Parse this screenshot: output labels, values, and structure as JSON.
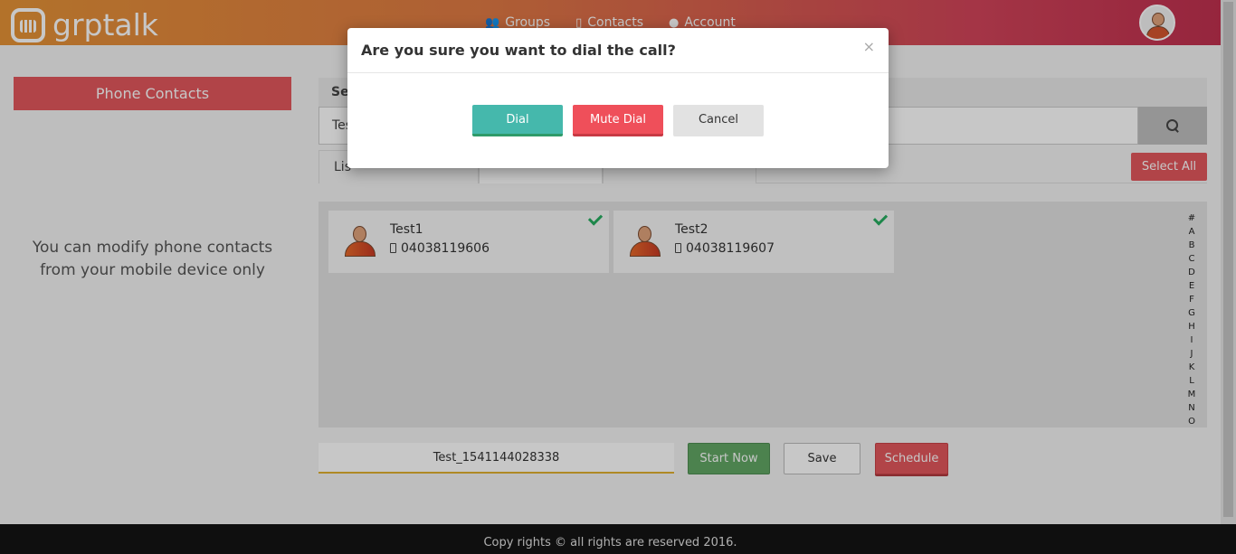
{
  "header": {
    "logo_text": "grptalk",
    "nav": [
      {
        "label": "Groups",
        "icon": "users-icon"
      },
      {
        "label": "Contacts",
        "icon": "mobile-icon"
      },
      {
        "label": "Account",
        "icon": "user-icon"
      }
    ]
  },
  "sidebar": {
    "button_label": "Phone Contacts",
    "note": "You can modify phone contacts from your mobile device only"
  },
  "search": {
    "label": "Se",
    "value": "Tes"
  },
  "tabs": [
    {
      "label": "Lis"
    },
    {
      "label": ""
    },
    {
      "label": ""
    }
  ],
  "select_all_label": "Select All",
  "contacts": [
    {
      "name": "Test1",
      "phone": "04038119606",
      "selected": true
    },
    {
      "name": "Test2",
      "phone": "04038119607",
      "selected": true
    }
  ],
  "alphabet": [
    "#",
    "A",
    "B",
    "C",
    "D",
    "E",
    "F",
    "G",
    "H",
    "I",
    "J",
    "K",
    "L",
    "M",
    "N",
    "O"
  ],
  "group_name": "Test_1541144028338",
  "actions": {
    "start_now": "Start Now",
    "save": "Save",
    "schedule": "Schedule"
  },
  "footer": {
    "text": "Copy rights © all rights are reserved 2016."
  },
  "modal": {
    "title": "Are you sure you want to dial the call?",
    "close": "×",
    "dial": "Dial",
    "mute_dial": "Mute Dial",
    "cancel": "Cancel"
  },
  "colors": {
    "accent_red": "#e3585d",
    "dial_teal": "#45b8ac",
    "start_green": "#62a765"
  }
}
